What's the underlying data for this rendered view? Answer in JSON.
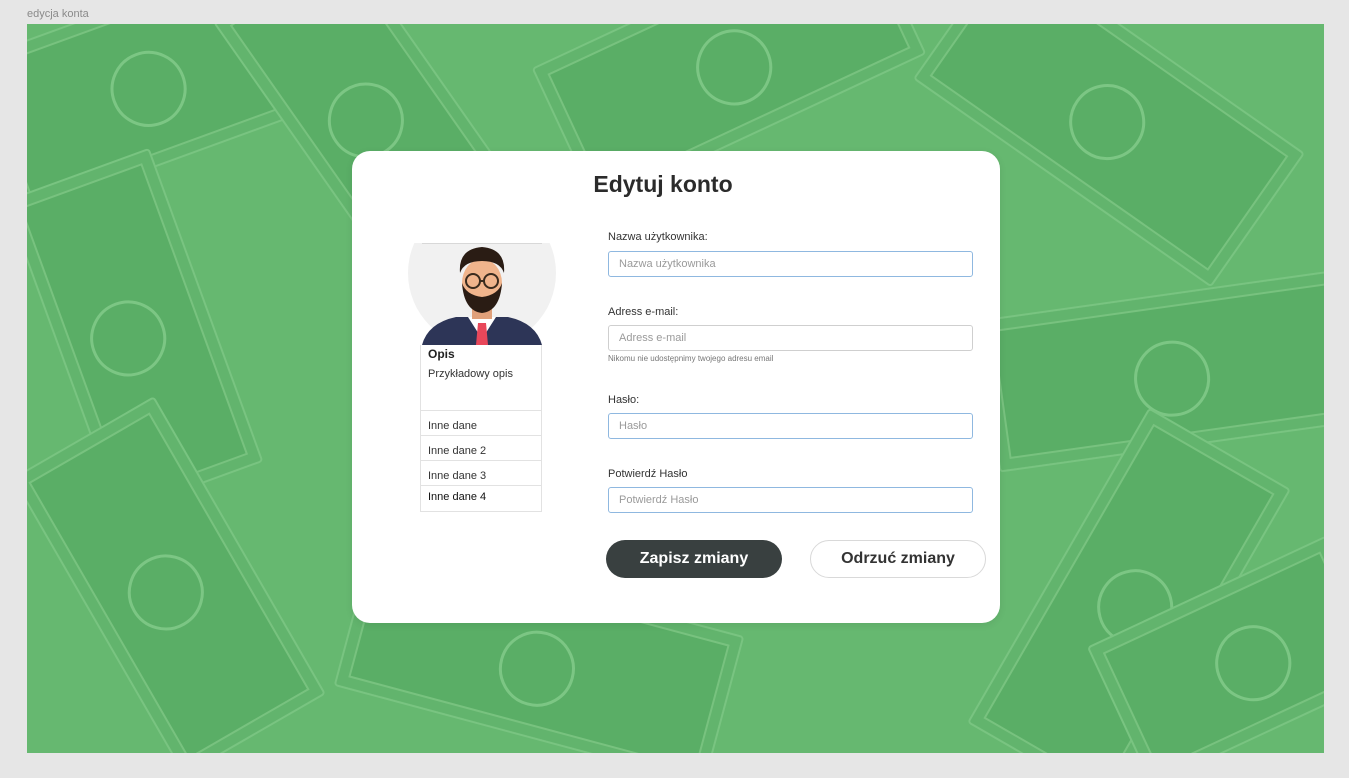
{
  "frame": {
    "label": "edycja konta"
  },
  "background": {
    "color": "#66b870",
    "pattern": "dollar-bills"
  },
  "modal": {
    "title": "Edytuj konto"
  },
  "profile": {
    "avatar_icon": "user-avatar-icon",
    "description_title": "Opis",
    "description_text": "Przykładowy opis",
    "other_data": [
      "Inne dane",
      "Inne dane 2",
      "Inne dane 3",
      "Inne dane 4"
    ]
  },
  "form": {
    "username": {
      "label": "Nazwa użytkownika:",
      "placeholder": "Nazwa użytkownika",
      "value": ""
    },
    "email": {
      "label": "Adress e-mail:",
      "placeholder": "Adress e-mail",
      "value": "",
      "hint": "Nikomu nie udostępnimy twojego adresu email"
    },
    "password": {
      "label": "Hasło:",
      "placeholder": "Hasło",
      "value": ""
    },
    "confirm_password": {
      "label": "Potwierdź Hasło",
      "placeholder": "Potwierdź Hasło",
      "value": ""
    }
  },
  "buttons": {
    "save_label": "Zapisz zmiany",
    "discard_label": "Odrzuć zmiany"
  },
  "colors": {
    "save_button": "#394040",
    "input_focus_border": "#8fb8e0"
  }
}
